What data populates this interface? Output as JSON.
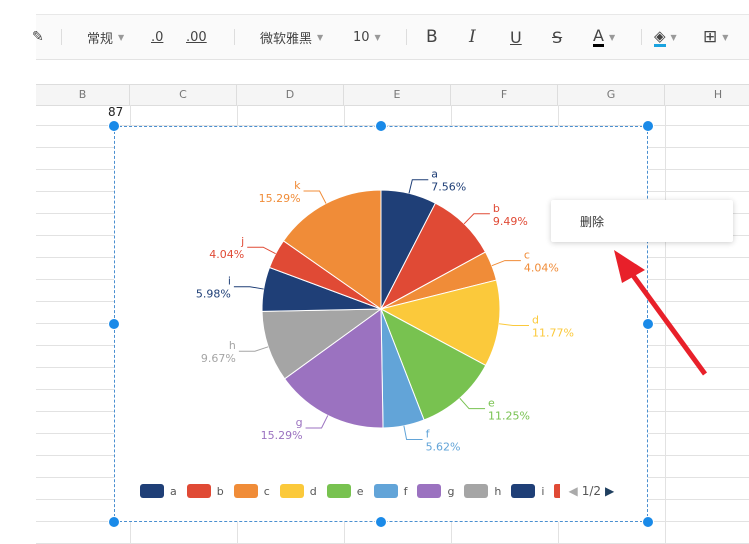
{
  "toolbar": {
    "number_format": "常规",
    "decrease_decimal": ".0",
    "increase_decimal": ".00",
    "font": "微软雅黑",
    "font_size": "10",
    "bold": "B",
    "italic": "I",
    "underline": "U",
    "strike": "S",
    "font_color": "A"
  },
  "columns": [
    "B",
    "C",
    "D",
    "E",
    "F",
    "G",
    "H"
  ],
  "cell_value": "87",
  "context_menu": {
    "delete": "删除"
  },
  "legend_page": "1/2",
  "chart_data": {
    "type": "pie",
    "categories": [
      "a",
      "b",
      "c",
      "d",
      "e",
      "f",
      "g",
      "h",
      "i",
      "j",
      "k"
    ],
    "values": [
      7.56,
      9.49,
      4.04,
      11.77,
      11.25,
      5.62,
      15.29,
      9.67,
      5.98,
      4.04,
      15.29
    ],
    "labels": [
      "7.56%",
      "9.49%",
      "4.04%",
      "11.77%",
      "11.25%",
      "5.62%",
      "15.29%",
      "9.67%",
      "5.98%",
      "4.04%",
      "15.29%"
    ],
    "colors": [
      "#1f3f77",
      "#e04a35",
      "#f08c38",
      "#fbc93b",
      "#78c250",
      "#62a4d8",
      "#9b72c0",
      "#a5a5a5",
      "#1f3f77",
      "#e04a35",
      "#f08c38"
    ],
    "legend_visible": [
      "a",
      "b",
      "c",
      "d",
      "e",
      "f",
      "g",
      "h",
      "i"
    ],
    "legend_placement": "bottom"
  }
}
